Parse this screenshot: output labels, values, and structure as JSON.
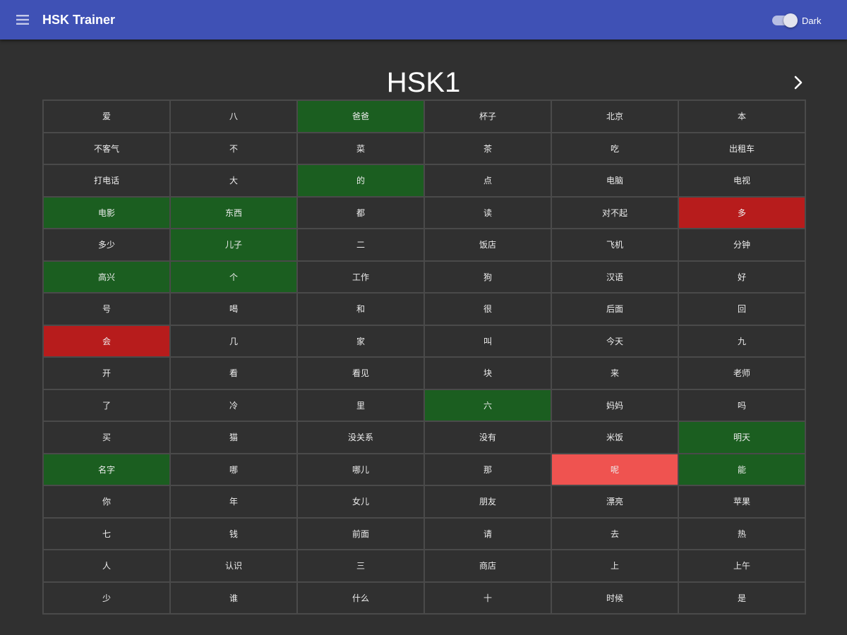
{
  "app_bar": {
    "title": "HSK Trainer",
    "menu_icon": "menu-icon",
    "toggle_label": "Dark",
    "toggle_on": true,
    "color": "#3f51b5"
  },
  "page": {
    "level_title": "HSK1",
    "next_icon": "chevron-right-icon"
  },
  "colors": {
    "correct": "#1b5e20",
    "wrong": "#b71c1c",
    "wrong_light": "#ef5350",
    "background": "#303030"
  },
  "grid": {
    "rows": [
      [
        {
          "text": "爱"
        },
        {
          "text": "八"
        },
        {
          "text": "爸爸",
          "status": "green"
        },
        {
          "text": "杯子"
        },
        {
          "text": "北京"
        },
        {
          "text": "本"
        }
      ],
      [
        {
          "text": "不客气"
        },
        {
          "text": "不"
        },
        {
          "text": "菜"
        },
        {
          "text": "茶"
        },
        {
          "text": "吃"
        },
        {
          "text": "出租车"
        }
      ],
      [
        {
          "text": "打电话"
        },
        {
          "text": "大"
        },
        {
          "text": "的",
          "status": "green"
        },
        {
          "text": "点"
        },
        {
          "text": "电脑"
        },
        {
          "text": "电视"
        }
      ],
      [
        {
          "text": "电影",
          "status": "green"
        },
        {
          "text": "东西",
          "status": "green"
        },
        {
          "text": "都"
        },
        {
          "text": "读"
        },
        {
          "text": "对不起"
        },
        {
          "text": "多",
          "status": "red"
        }
      ],
      [
        {
          "text": "多少"
        },
        {
          "text": "儿子",
          "status": "green"
        },
        {
          "text": "二"
        },
        {
          "text": "饭店"
        },
        {
          "text": "飞机"
        },
        {
          "text": "分钟"
        }
      ],
      [
        {
          "text": "高兴",
          "status": "green"
        },
        {
          "text": "个",
          "status": "green"
        },
        {
          "text": "工作"
        },
        {
          "text": "狗"
        },
        {
          "text": "汉语"
        },
        {
          "text": "好"
        }
      ],
      [
        {
          "text": "号"
        },
        {
          "text": "喝"
        },
        {
          "text": "和"
        },
        {
          "text": "很"
        },
        {
          "text": "后面"
        },
        {
          "text": "回"
        }
      ],
      [
        {
          "text": "会",
          "status": "red"
        },
        {
          "text": "几"
        },
        {
          "text": "家"
        },
        {
          "text": "叫"
        },
        {
          "text": "今天"
        },
        {
          "text": "九"
        }
      ],
      [
        {
          "text": "开"
        },
        {
          "text": "看"
        },
        {
          "text": "看见"
        },
        {
          "text": "块"
        },
        {
          "text": "来"
        },
        {
          "text": "老师"
        }
      ],
      [
        {
          "text": "了"
        },
        {
          "text": "冷"
        },
        {
          "text": "里"
        },
        {
          "text": "六",
          "status": "green"
        },
        {
          "text": "妈妈"
        },
        {
          "text": "吗"
        }
      ],
      [
        {
          "text": "买"
        },
        {
          "text": "猫"
        },
        {
          "text": "没关系"
        },
        {
          "text": "没有"
        },
        {
          "text": "米饭"
        },
        {
          "text": "明天",
          "status": "green"
        }
      ],
      [
        {
          "text": "名字",
          "status": "green"
        },
        {
          "text": "哪"
        },
        {
          "text": "哪儿"
        },
        {
          "text": "那"
        },
        {
          "text": "呢",
          "status": "lightred"
        },
        {
          "text": "能",
          "status": "green"
        }
      ],
      [
        {
          "text": "你"
        },
        {
          "text": "年"
        },
        {
          "text": "女儿"
        },
        {
          "text": "朋友"
        },
        {
          "text": "漂亮"
        },
        {
          "text": "苹果"
        }
      ],
      [
        {
          "text": "七"
        },
        {
          "text": "钱"
        },
        {
          "text": "前面"
        },
        {
          "text": "请"
        },
        {
          "text": "去"
        },
        {
          "text": "热"
        }
      ],
      [
        {
          "text": "人"
        },
        {
          "text": "认识"
        },
        {
          "text": "三"
        },
        {
          "text": "商店"
        },
        {
          "text": "上"
        },
        {
          "text": "上午"
        }
      ],
      [
        {
          "text": "少"
        },
        {
          "text": "谁"
        },
        {
          "text": "什么"
        },
        {
          "text": "十"
        },
        {
          "text": "时候"
        },
        {
          "text": "是"
        }
      ]
    ]
  }
}
